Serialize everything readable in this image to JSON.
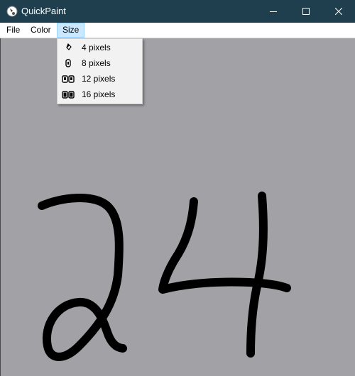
{
  "window": {
    "title": "QuickPaint",
    "icons": [
      "app-icon",
      "minimize-icon",
      "maximize-icon",
      "close-icon"
    ]
  },
  "menubar": {
    "items": [
      {
        "label": "File"
      },
      {
        "label": "Color"
      },
      {
        "label": "Size",
        "active": true
      }
    ]
  },
  "size_menu": {
    "items": [
      {
        "label": "4 pixels",
        "icon": "small-brush-icon"
      },
      {
        "label": "8 pixels",
        "icon": "medium-brush-icon"
      },
      {
        "label": "12 pixels",
        "icon": "large-brush-icon"
      },
      {
        "label": "16 pixels",
        "icon": "xlarge-brush-icon"
      }
    ]
  },
  "canvas": {
    "background": "#a2a1a6",
    "stroke_color": "#000000"
  },
  "colors": {
    "titlebar": "#1f3f4f",
    "menu_highlight": "#cce8ff"
  }
}
